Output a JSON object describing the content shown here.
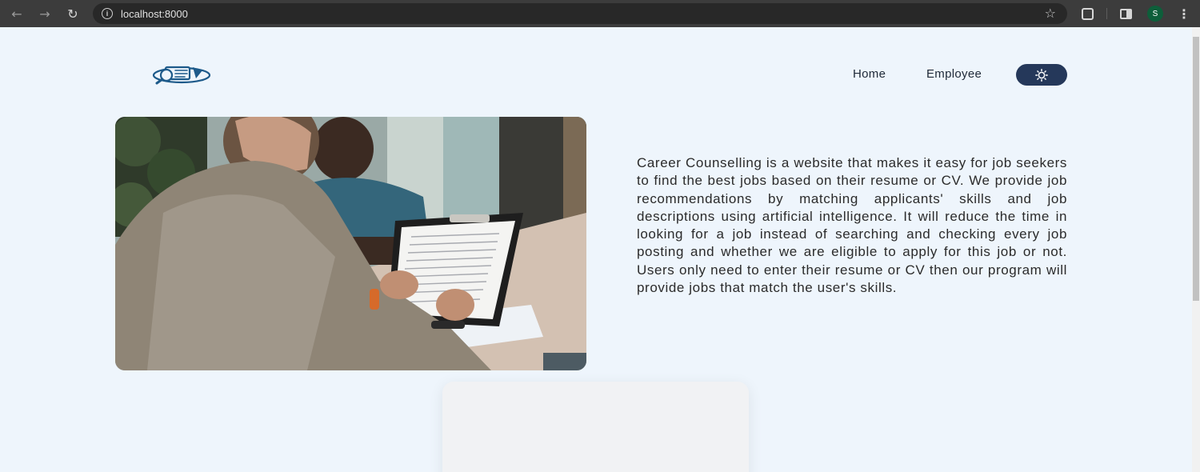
{
  "browser": {
    "url": "localhost:8000",
    "profile_initial": "S"
  },
  "header": {
    "logo_icon": "resume-search-icon",
    "nav": [
      {
        "label": "Home"
      },
      {
        "label": "Employee"
      }
    ],
    "theme_toggle_icon": "sun-icon"
  },
  "hero": {
    "image_icon": "job-interview-photo",
    "description": "Career Counselling is a website that makes it easy for job seekers to find the best jobs based on their resume or CV. We provide job recommendations by matching applicants' skills and job descriptions using artificial intelligence. It will reduce the time in looking for a job instead of searching and checking every job posting and whether we are eligible to apply for this job or not. Users only need to enter their resume or CV then our program will provide jobs that match the user's skills."
  },
  "colors": {
    "page_bg": "#eef5fc",
    "accent": "#25385a",
    "logo": "#1d5a8a"
  }
}
